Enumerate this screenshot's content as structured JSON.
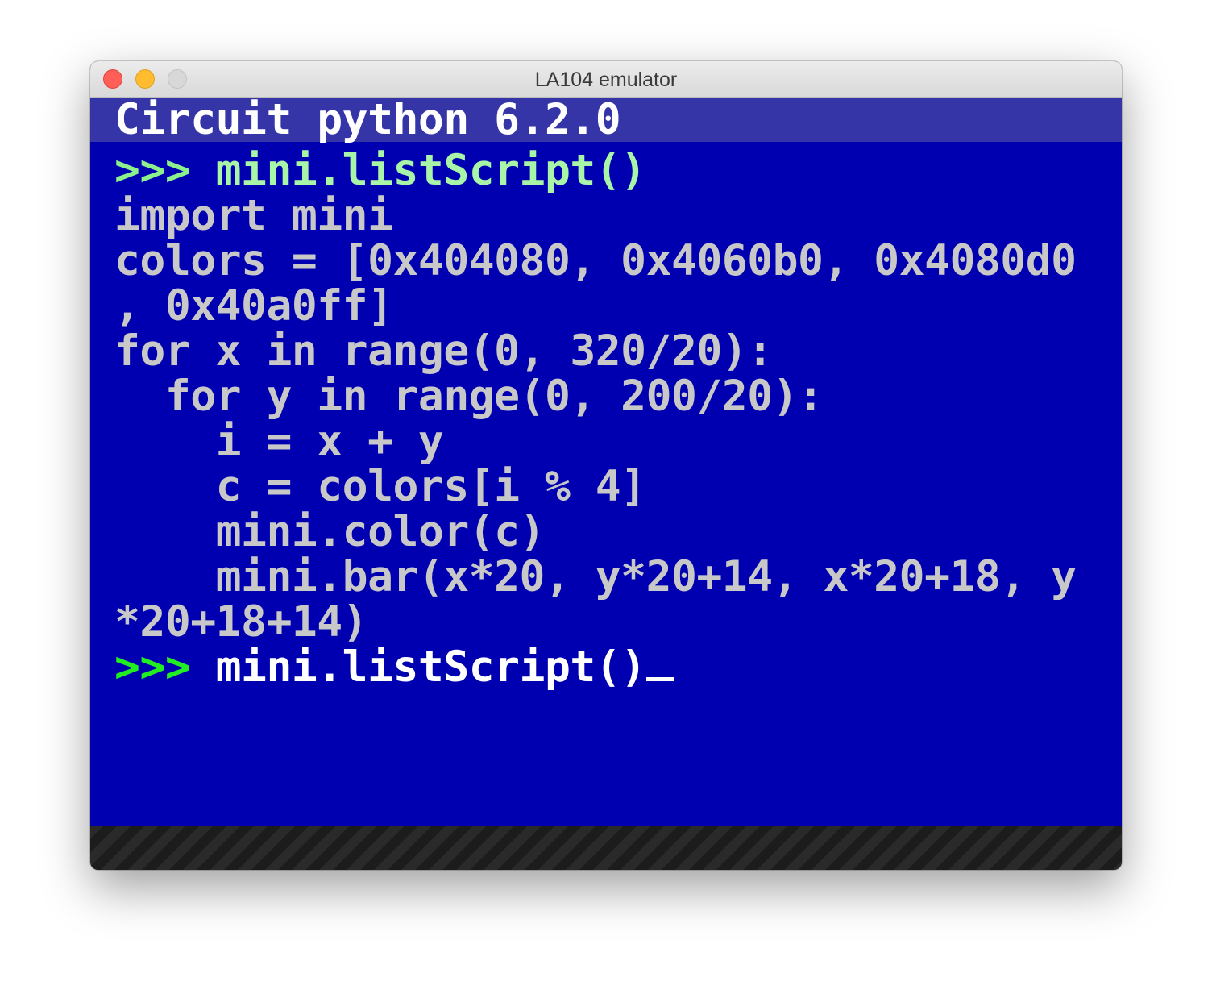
{
  "window": {
    "title": "LA104 emulator"
  },
  "terminal": {
    "banner": "Circuit python 6.2.0",
    "history_prompt": ">>> ",
    "history_command": "mini.listScript()",
    "output_lines": [
      "import mini",
      "colors = [0x404080, 0x4060b0, 0x4080d0",
      ", 0x40a0ff]",
      "for x in range(0, 320/20):",
      "  for y in range(0, 200/20):",
      "    i = x + y",
      "    c = colors[i % 4]",
      "    mini.color(c)",
      "    mini.bar(x*20, y*20+14, x*20+18, y",
      "*20+18+14)"
    ],
    "current_prompt": ">>> ",
    "current_command": "mini.listScript()"
  },
  "colors": {
    "screen_bg": "#0000b0",
    "banner_bg": "#3535a8",
    "code_text": "#c8c8c8",
    "prompt_green": "#22ee22"
  }
}
